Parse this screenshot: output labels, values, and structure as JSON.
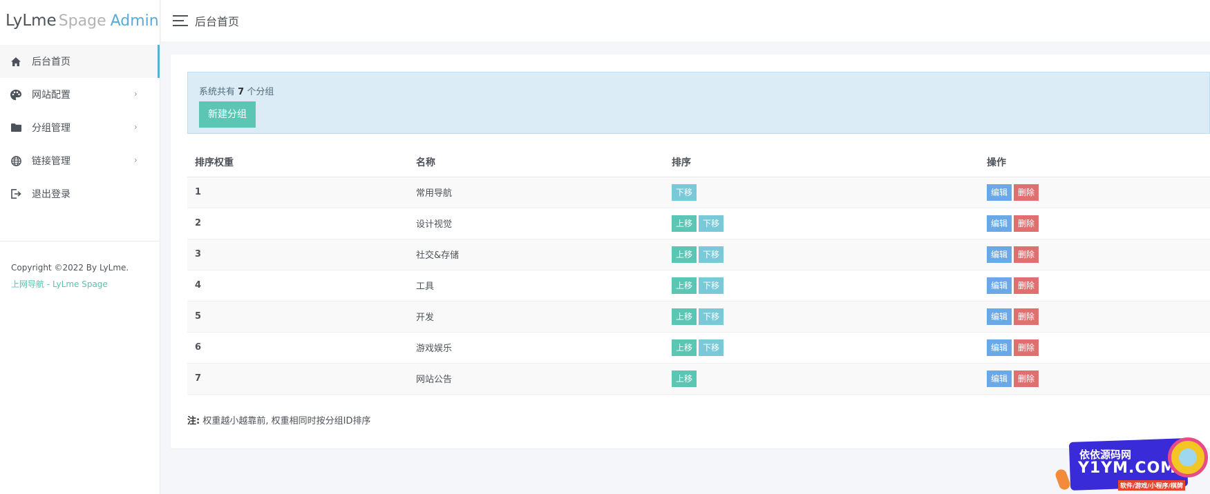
{
  "brand": {
    "part1": "LyLme",
    "part2": "Spage",
    "part3": "Admin"
  },
  "topbar": {
    "title": "后台首页"
  },
  "sidebar": {
    "items": [
      {
        "label": "后台首页",
        "icon": "home-icon",
        "active": true,
        "has_arrow": false
      },
      {
        "label": "网站配置",
        "icon": "palette-icon",
        "active": false,
        "has_arrow": true
      },
      {
        "label": "分组管理",
        "icon": "folder-icon",
        "active": false,
        "has_arrow": true
      },
      {
        "label": "链接管理",
        "icon": "globe-icon",
        "active": false,
        "has_arrow": true
      },
      {
        "label": "退出登录",
        "icon": "logout-icon",
        "active": false,
        "has_arrow": false
      }
    ],
    "arrow": "›",
    "copyright": "Copyright ©2022 By LyLme.",
    "link": "上网导航 - LyLme Spage"
  },
  "alert": {
    "prefix": "系统共有",
    "count": "7",
    "suffix": "个分组",
    "new_button": "新建分组"
  },
  "table": {
    "headers": {
      "weight": "排序权重",
      "name": "名称",
      "sort": "排序",
      "ops": "操作"
    },
    "rows": [
      {
        "weight": "1",
        "name": "常用导航",
        "up": false,
        "down": true
      },
      {
        "weight": "2",
        "name": "设计视觉",
        "up": true,
        "down": true
      },
      {
        "weight": "3",
        "name": "社交&存储",
        "up": true,
        "down": true
      },
      {
        "weight": "4",
        "name": "工具",
        "up": true,
        "down": true
      },
      {
        "weight": "5",
        "name": "开发",
        "up": true,
        "down": true
      },
      {
        "weight": "6",
        "name": "游戏娱乐",
        "up": true,
        "down": true
      },
      {
        "weight": "7",
        "name": "网站公告",
        "up": true,
        "down": false
      }
    ],
    "labels": {
      "up": "上移",
      "down": "下移",
      "edit": "编辑",
      "delete": "删除"
    }
  },
  "note": {
    "prefix": "注:",
    "text": "权重越小越靠前, 权重相同时按分组ID排序"
  },
  "watermark": {
    "line1": "依依源码网",
    "line2": "Y1YM.COM",
    "line3": "软件/游戏/小程序/棋牌"
  },
  "colors": {
    "accent_teal": "#5cc6b4",
    "info": "#79c9d9",
    "edit": "#6aa8e8",
    "danger": "#e07070",
    "brand_admin": "#5ba9d6"
  }
}
